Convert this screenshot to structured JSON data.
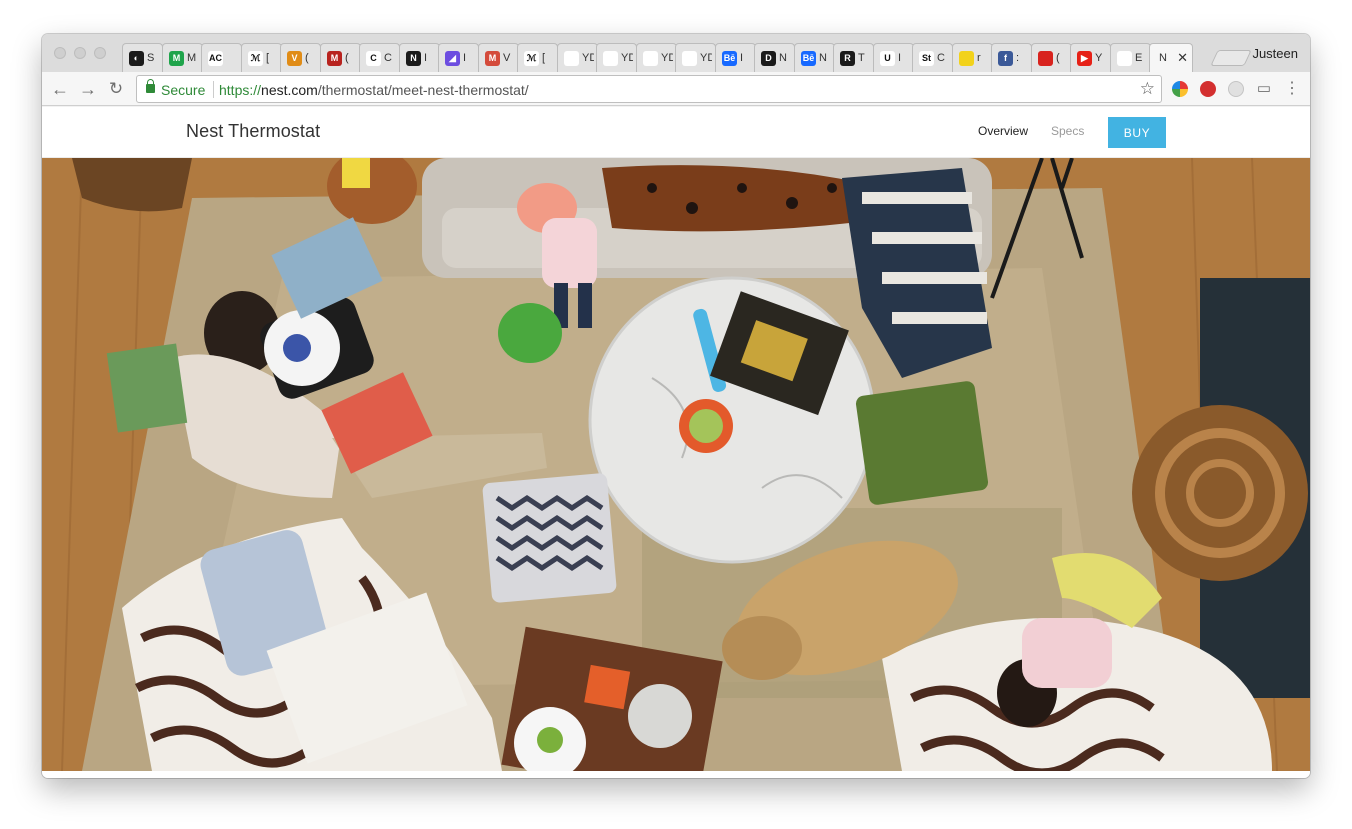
{
  "browser": {
    "tabs": [
      {
        "favicon": "headphones-icon",
        "label": "S",
        "color": "#1b1b1b",
        "glyph": "◐"
      },
      {
        "favicon": "medium-icon",
        "label": "M",
        "color": "#1fa44b",
        "glyph": "M"
      },
      {
        "favicon": "ac-icon",
        "label": "",
        "color": "#ffffff",
        "glyph": "AC"
      },
      {
        "favicon": "wd-icon",
        "label": "[",
        "color": "#ffffff",
        "glyph": "ℳ"
      },
      {
        "favicon": "shield-icon",
        "label": "(",
        "color": "#e08c17",
        "glyph": "V"
      },
      {
        "favicon": "m-logo-icon",
        "label": "(",
        "color": "#b8231f",
        "glyph": "M"
      },
      {
        "favicon": "c-logo-icon",
        "label": "C",
        "color": "#ffffff",
        "glyph": "C"
      },
      {
        "favicon": "n-logo-icon",
        "label": "I",
        "color": "#1b1b1b",
        "glyph": "N"
      },
      {
        "favicon": "chart-icon",
        "label": "I",
        "color": "#6c4de0",
        "glyph": "◢"
      },
      {
        "favicon": "gmail-icon",
        "label": "V",
        "color": "#d44b3b",
        "glyph": "M"
      },
      {
        "favicon": "wd-icon",
        "label": "[",
        "color": "#ffffff",
        "glyph": "ℳ"
      },
      {
        "favicon": "yd-icon",
        "label": "YD [",
        "color": "#ffffff",
        "glyph": ""
      },
      {
        "favicon": "yd-icon",
        "label": "YD [",
        "color": "#ffffff",
        "glyph": ""
      },
      {
        "favicon": "yd-icon",
        "label": "YD T",
        "color": "#ffffff",
        "glyph": ""
      },
      {
        "favicon": "yd-icon",
        "label": "YD T",
        "color": "#ffffff",
        "glyph": ""
      },
      {
        "favicon": "behance-icon",
        "label": "I",
        "color": "#1769ff",
        "glyph": "Bē"
      },
      {
        "favicon": "d-logo-icon",
        "label": "N",
        "color": "#1b1b1b",
        "glyph": "D"
      },
      {
        "favicon": "behance-icon",
        "label": "N",
        "color": "#1769ff",
        "glyph": "Bē"
      },
      {
        "favicon": "r-logo-icon",
        "label": "T",
        "color": "#1b1b1b",
        "glyph": "R"
      },
      {
        "favicon": "u-logo-icon",
        "label": "I",
        "color": "#ffffff",
        "glyph": "U"
      },
      {
        "favicon": "st-icon",
        "label": "C",
        "color": "#ffffff",
        "glyph": "St"
      },
      {
        "favicon": "tag-icon",
        "label": "r",
        "color": "#f2d21b",
        "glyph": ""
      },
      {
        "favicon": "facebook-icon",
        "label": ":",
        "color": "#3b5998",
        "glyph": "f"
      },
      {
        "favicon": "flag-icon",
        "label": "(",
        "color": "#d8231e",
        "glyph": ""
      },
      {
        "favicon": "youtube-icon",
        "label": "Y",
        "color": "#e62117",
        "glyph": "▶"
      },
      {
        "favicon": "e-icon",
        "label": "E",
        "color": "#ffffff",
        "glyph": ""
      }
    ],
    "active_tab_label": "N",
    "profile_name": "Justeen",
    "secure_label": "Secure",
    "url_scheme": "https://",
    "url_host": "nest.com",
    "url_path": "/thermostat/meet-nest-thermostat/"
  },
  "site": {
    "brand": "Nest Thermostat",
    "nav_overview": "Overview",
    "nav_specs": "Specs",
    "buy_label": "BUY",
    "accent_color": "#42b3e2"
  }
}
